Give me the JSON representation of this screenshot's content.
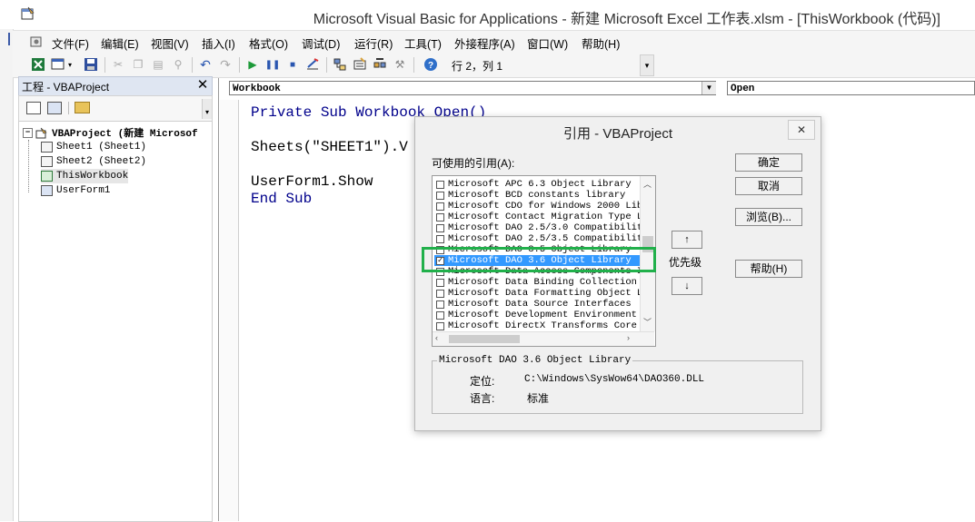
{
  "window": {
    "title": "Microsoft Visual Basic for Applications - 新建 Microsoft Excel 工作表.xlsm - [ThisWorkbook (代码)]"
  },
  "menu": {
    "items": [
      "文件(F)",
      "编辑(E)",
      "视图(V)",
      "插入(I)",
      "格式(O)",
      "调试(D)",
      "运行(R)",
      "工具(T)",
      "外接程序(A)",
      "窗口(W)",
      "帮助(H)"
    ]
  },
  "toolbar": {
    "position": "行 2，列 1"
  },
  "project": {
    "title": "工程 - VBAProject",
    "root": "VBAProject (新建 Microsof",
    "items": [
      "Sheet1 (Sheet1)",
      "Sheet2 (Sheet2)",
      "ThisWorkbook",
      "UserForm1"
    ]
  },
  "code": {
    "object_combo": "Workbook",
    "proc_combo": "Open",
    "lines": [
      "Private Sub Workbook_Open()",
      "Sheets(\"SHEET1\").V",
      "UserForm1.Show",
      "End Sub"
    ]
  },
  "dialog": {
    "title": "引用 - VBAProject",
    "list_label": "可使用的引用(A):",
    "references": [
      {
        "name": "Microsoft APC 6.3 Object Library",
        "checked": false
      },
      {
        "name": "Microsoft BCD constants library",
        "checked": false
      },
      {
        "name": "Microsoft CDO for Windows 2000 Libr",
        "checked": false
      },
      {
        "name": "Microsoft Contact Migration Type Li",
        "checked": false
      },
      {
        "name": "Microsoft DAO 2.5/3.0 Compatibility",
        "checked": false
      },
      {
        "name": "Microsoft DAO 2.5/3.5 Compatibility",
        "checked": false
      },
      {
        "name": "Microsoft DAO 3.5 Object Library",
        "checked": false
      },
      {
        "name": "Microsoft DAO 3.6 Object Library",
        "checked": true,
        "selected": true
      },
      {
        "name": "Microsoft Data Access Components In",
        "checked": false
      },
      {
        "name": "Microsoft Data Binding Collection V",
        "checked": false
      },
      {
        "name": "Microsoft Data Formatting Object Li",
        "checked": false
      },
      {
        "name": "Microsoft Data Source Interfaces",
        "checked": false
      },
      {
        "name": "Microsoft Development Environment 8",
        "checked": false
      },
      {
        "name": "Microsoft DirectX Transforms Core T",
        "checked": false
      }
    ],
    "buttons": {
      "ok": "确定",
      "cancel": "取消",
      "browse": "浏览(B)...",
      "help": "帮助(H)"
    },
    "priority_label": "优先级",
    "priority_up": "↑",
    "priority_down": "↓",
    "info": {
      "name": "Microsoft DAO 3.6 Object Library",
      "location_key": "定位:",
      "location_val": "C:\\Windows\\SysWow64\\DAO360.DLL",
      "language_key": "语言:",
      "language_val": "标准"
    }
  },
  "colors": {
    "highlight": "#21b04b",
    "selection": "#3399ff",
    "code_keyword": "#00008b"
  }
}
